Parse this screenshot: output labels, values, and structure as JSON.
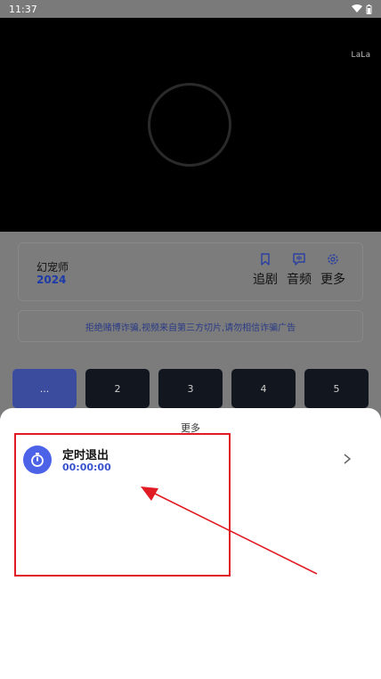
{
  "status_bar": {
    "time": "11:37"
  },
  "video": {
    "watermark": "LaLa"
  },
  "show": {
    "title": "幻宠师",
    "year": "2024"
  },
  "actions": [
    {
      "label": "追剧",
      "icon": "bookmark-icon"
    },
    {
      "label": "音频",
      "icon": "audio-icon"
    },
    {
      "label": "更多",
      "icon": "gear-icon"
    }
  ],
  "notice": "拒绝赌博诈骗,视频来自第三方切片,请勿相信诈骗广告",
  "episodes": [
    "...",
    "2",
    "3",
    "4",
    "5"
  ],
  "sheet": {
    "title": "更多",
    "timer": {
      "label": "定时退出",
      "value": "00:00:00",
      "icon": "stopwatch-icon"
    }
  },
  "colors": {
    "accent": "#4c63e8",
    "annotation": "#e01b24"
  }
}
